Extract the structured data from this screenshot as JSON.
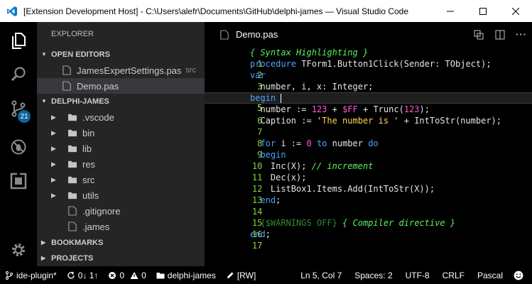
{
  "window": {
    "title": "[Extension Development Host] - C:\\Users\\alefr\\Documents\\GitHub\\delphi-james — Visual Studio Code"
  },
  "activity": {
    "scm_badge": "21"
  },
  "sidebar": {
    "title": "EXPLORER",
    "open_editors": {
      "header": "OPEN EDITORS",
      "items": [
        {
          "label": "JamesExpertSettings.pas",
          "desc": "src"
        },
        {
          "label": "Demo.pas",
          "desc": ""
        }
      ]
    },
    "project": {
      "header": "DELPHI-JAMES",
      "folders": [
        ".vscode",
        "bin",
        "lib",
        "res",
        "src",
        "utils"
      ],
      "files": [
        ".gitignore",
        ".james"
      ]
    },
    "bookmarks_header": "BOOKMARKS",
    "projects_header": "PROJECTS"
  },
  "editor": {
    "tab_label": "Demo.pas",
    "line_numbers": [
      "1",
      "2",
      "3",
      "4",
      "5",
      "6",
      "7",
      "8",
      "9",
      "10",
      "11",
      "12",
      "13",
      "14",
      "15",
      "16",
      "17"
    ]
  },
  "code": {
    "l1_comment": "{ Syntax Highlighting }",
    "l2_kw": "procedure",
    "l2_rest": " TForm1.Button1Click(Sender: TObject);",
    "l3_kw": "var",
    "l4_a": "  number, i, x: ",
    "l4_type": "Integer",
    "l4_b": ";",
    "l5_kw": "begin",
    "l6_a": "  number := ",
    "l6_n1": "123",
    "l6_b": " + ",
    "l6_n2": "$FF",
    "l6_c": " + Trunc(",
    "l6_n3": "123",
    "l6_d": ");",
    "l7_a": "  Caption := ",
    "l7_str": "'The number is '",
    "l7_b": " + IntToStr(number);",
    "l9_kw1": "  for",
    "l9_a": " i := ",
    "l9_n": "0",
    "l9_kw2": " to",
    "l9_b": " number ",
    "l9_kw3": "do",
    "l10_kw": "  begin",
    "l11_a": "    Inc(X); ",
    "l11_comment": "// increment",
    "l12": "    Dec(x);",
    "l13": "    ListBox1.Items.Add(IntToStr(X));",
    "l14_kw": "  end",
    "l14_b": ";",
    "l16_dir": "  {$WARNINGS OFF}",
    "l16_comment": " { Compiler directive }",
    "l17_kw": "end",
    "l17_b": ";"
  },
  "statusbar": {
    "branch": "ide-plugin*",
    "sync": "0↓ 1↑",
    "errors": "0",
    "warnings": "0",
    "folder": "delphi-james",
    "rw": "[RW]",
    "position": "Ln 5, Col 7",
    "spaces": "Spaces: 2",
    "encoding": "UTF-8",
    "eol": "CRLF",
    "language": "Pascal"
  }
}
